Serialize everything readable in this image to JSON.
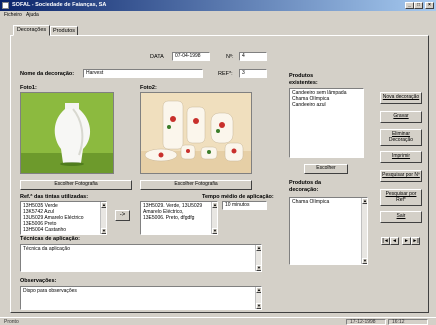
{
  "window": {
    "title": "SOFAL - Sociedade de Faianças, SA"
  },
  "menu": {
    "items": [
      "Ficheiro",
      "Ajuda"
    ]
  },
  "tabs": [
    {
      "label": "Decorações"
    },
    {
      "label": "Produtos"
    }
  ],
  "form": {
    "data_label": "DATA",
    "data_value": "07-04-1998",
    "num_label": "Nº:",
    "num_value": "4",
    "nome_label": "Nome da decoração:",
    "nome_value": "Harvest",
    "ref_label": "REF*:",
    "ref_value": "3",
    "foto1_label": "Foto1:",
    "foto2_label": "Foto2:",
    "escolher_foto1": "Escolher Fotografia",
    "escolher_foto2": "Escolher Fotografia",
    "tintas_label": "Ref.ª das tintas utilizadas:",
    "tintas": [
      "13H5035 Verde",
      "13K5742 Azul",
      "13U5029 Amarelo Eléctrico",
      "13E5006 Preto",
      "13H5004 Castanho"
    ],
    "tintas_sel": [
      "13H5029. Verde, 13U5029 Amarelo Eléctrico,",
      "13E5006. Preto, dfgdfg"
    ],
    "transfer_label": "->",
    "tempo_label": "Tempo médio de aplicação:",
    "tempo_value": "10 minutos",
    "tecnicas_label": "Técnicas de aplicação:",
    "tecnicas_value": "Técnica da aplicação",
    "obs_label": "Observações:",
    "obs_value": "Dispo para observações"
  },
  "produtos_existentes": {
    "label_line1": "Produtos",
    "label_line2": "existentes:",
    "items": [
      "Candeeiro sem lâmpada",
      "Chama Olímpica",
      "Candeeiro azul"
    ],
    "escolher": "Escolher"
  },
  "produtos_decoracao": {
    "label_line1": "Produtos da",
    "label_line2": "decoração:",
    "items": [
      "Chama Olímpica"
    ]
  },
  "buttons": {
    "nova": "Nova decoração",
    "gravar": "Gravar",
    "eliminar_l1": "Eliminar",
    "eliminar_l2": "Decoração",
    "imprimir": "Imprimir",
    "pesquisar_n": "Pesquisar por Nº",
    "pesquisar_ref_l1": "Pesquisar por",
    "pesquisar_ref_l2": "Ref*",
    "sair": "Sair"
  },
  "navigation": {
    "first": "|◄",
    "prev": "◄",
    "next": "►",
    "last": "►|"
  },
  "status": {
    "left": "Pronto",
    "date": "17-12-1998",
    "time": "16:12"
  }
}
